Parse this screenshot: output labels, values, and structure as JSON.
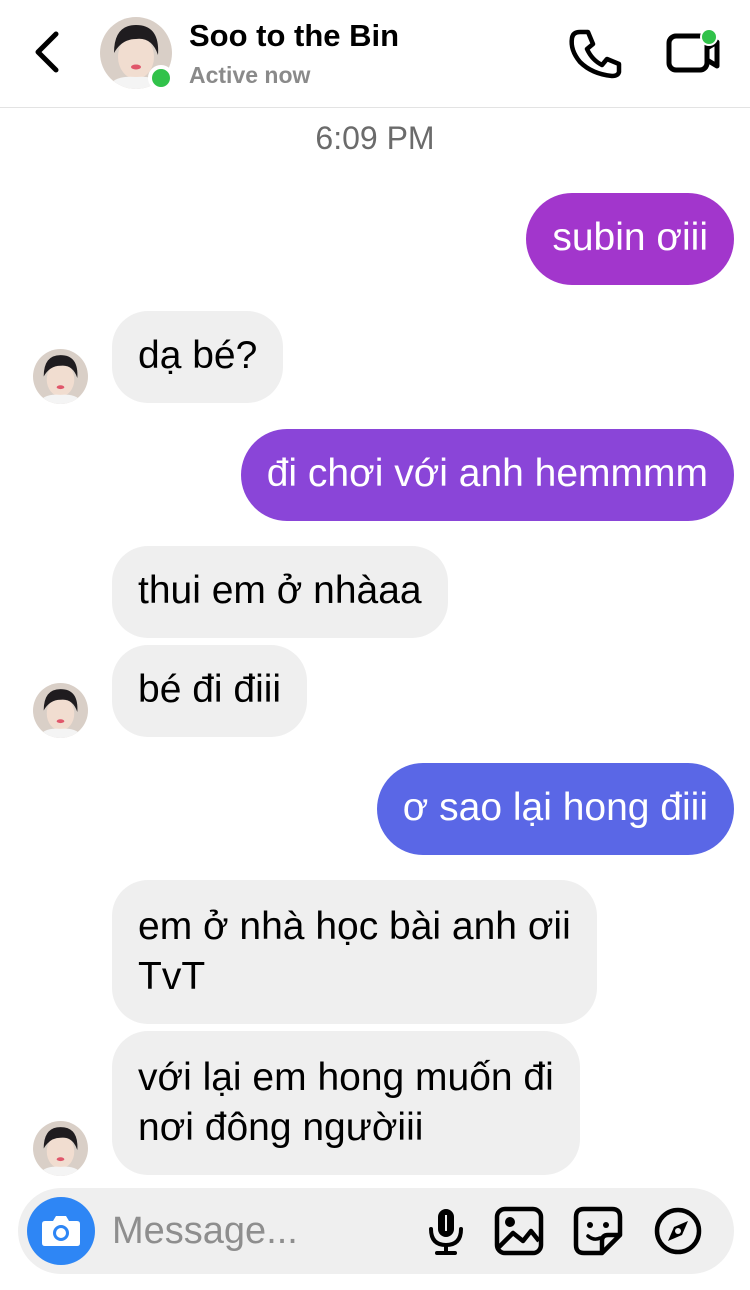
{
  "header": {
    "title": "Soo to the Bin",
    "status": "Active now",
    "icons": [
      "chevron-left-icon",
      "phone-icon",
      "video-icon"
    ],
    "presence_color": "#31c24a"
  },
  "conversation": {
    "timestamp": "6:09 PM",
    "messages": [
      {
        "from": "me",
        "text": "subin ơiii"
      },
      {
        "from": "them",
        "text": "dạ bé?"
      },
      {
        "from": "me",
        "text": "đi chơi với anh hemmmm"
      },
      {
        "from": "them",
        "text": "thui em ở nhàaa"
      },
      {
        "from": "them",
        "text": "bé đi điii"
      },
      {
        "from": "me",
        "text": "ơ sao lại hong điii"
      },
      {
        "from": "them",
        "lines": [
          "em ở nhà học bài anh ơii",
          "TvT"
        ]
      },
      {
        "from": "them",
        "lines": [
          "với lại em hong muốn đi",
          "nơi đông ngườiii"
        ]
      }
    ]
  },
  "composer": {
    "placeholder": "Message...",
    "icons": [
      "camera-icon",
      "microphone-icon",
      "image-icon",
      "sticker-icon",
      "compass-icon"
    ]
  },
  "colors": {
    "sent_gradient": [
      "#a236cc",
      "#8a45d8",
      "#5a67e6"
    ],
    "received_bg": "#efefef",
    "camera_button": "#2e86f5"
  }
}
